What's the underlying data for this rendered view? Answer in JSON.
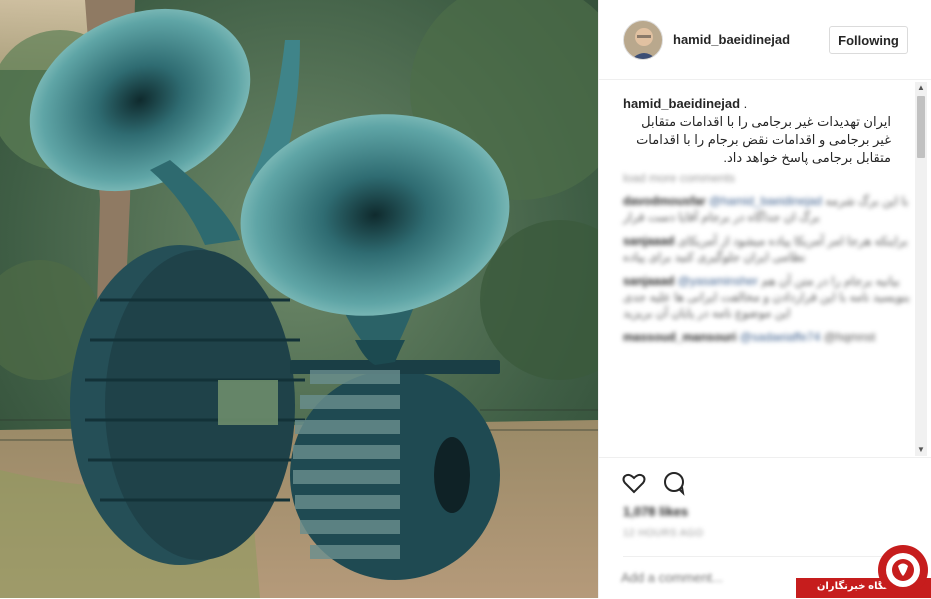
{
  "post": {
    "photo_description_icon": "sculpture-photo",
    "author": {
      "username": "hamid_baeidinejad",
      "follow_label": "Following"
    },
    "caption": {
      "author": "hamid_baeidinejad",
      "separator": " .",
      "text": "ایران تهدیدات غیر برجامی را با اقدامات متقابل غیر برجامی و اقدامات نقض برجام را با اقدامات متقابل برجامی پاسخ خواهد داد."
    },
    "load_more": "load more comments",
    "comments": [
      {
        "user": "davodmousfar",
        "mention": "@hamid_baeidinejad",
        "text": "با این برگ شرمه برگ ان جداگاه در برجام آقایا دست قرار"
      },
      {
        "user": "sanjaaad",
        "mention": "",
        "text": "براینکه هرجا امر آمریکا پیاده میشود از آمریکای نظامی ایران جلوگیری کنید برای پیاده"
      },
      {
        "user": "sanjaaad",
        "mention": "@yasaminsher",
        "text": "بیانیه برجام را در متن آن هم بنویسید نامه با این قراردادن و مخالفت ایرانی ها علیه جدی این موضوع نامه در پایان آن بریزید"
      },
      {
        "user": "massoud_mansouri",
        "mention": "@sadaeiaffe74",
        "text": "@hqmnst"
      }
    ],
    "likes": "1,078 likes",
    "time": "12 HOURS AGO",
    "add_comment_placeholder": "Add a comment...",
    "icons": {
      "like": "heart-icon",
      "comment": "comment-icon"
    }
  },
  "scrollbar": {
    "up": "▲",
    "down": "▼"
  },
  "watermark": {
    "text": "باشگاه خبرنگاران",
    "logo": "ybn-logo-icon",
    "color": "#c61d1d"
  }
}
